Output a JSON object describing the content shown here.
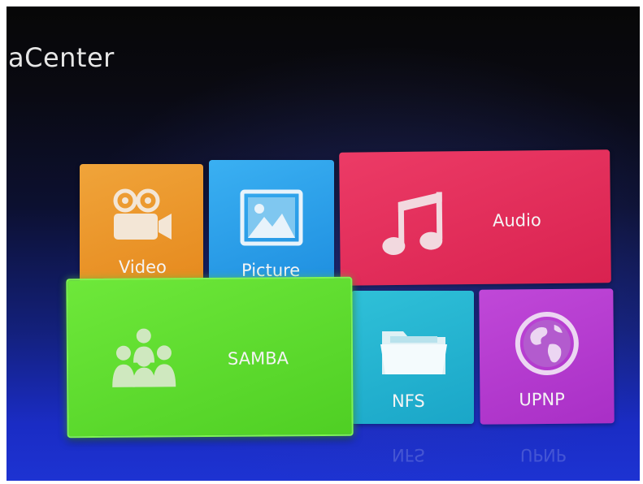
{
  "header": {
    "title": "aCenter"
  },
  "tiles": {
    "video": {
      "label": "Video",
      "icon": "video-camera-icon",
      "color": "#e68a1e"
    },
    "picture": {
      "label": "Picture",
      "icon": "picture-icon",
      "color": "#1f8fe0"
    },
    "audio": {
      "label": "Audio",
      "icon": "music-note-icon",
      "color": "#d92250"
    },
    "samba": {
      "label": "SAMBA",
      "icon": "people-group-icon",
      "color": "#4fcf24"
    },
    "nfs": {
      "label": "NFS",
      "icon": "folder-icon",
      "color": "#1aa6c8"
    },
    "upnp": {
      "label": "UPNP",
      "icon": "globe-icon",
      "color": "#a92fc6"
    }
  }
}
